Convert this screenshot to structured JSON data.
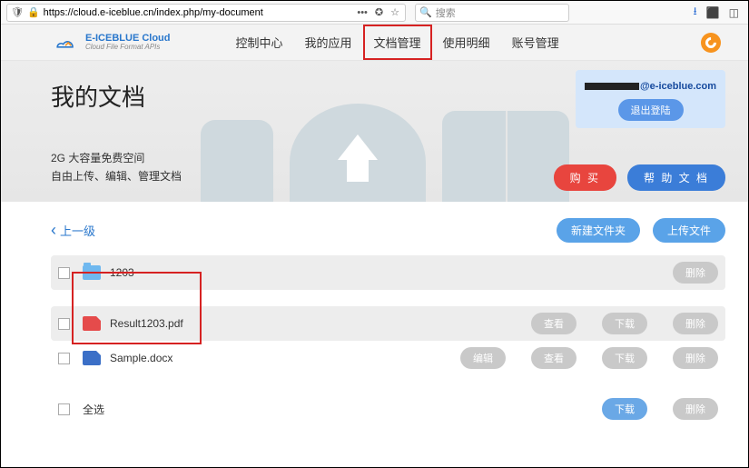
{
  "browser": {
    "url": "https://cloud.e-iceblue.cn/index.php/my-document",
    "search_placeholder": "搜索"
  },
  "brand": {
    "title": "E-ICEBLUE Cloud",
    "subtitle": "Cloud File Format APIs"
  },
  "nav": {
    "items": [
      {
        "label": "控制中心"
      },
      {
        "label": "我的应用"
      },
      {
        "label": "文档管理",
        "active": true
      },
      {
        "label": "使用明细"
      },
      {
        "label": "账号管理"
      }
    ]
  },
  "banner": {
    "title": "我的文档",
    "sub_line1": "2G 大容量免费空间",
    "sub_line2": "自由上传、编辑、管理文档",
    "email_suffix": "@e-iceblue.com",
    "logout": "退出登陆",
    "buy": "购 买",
    "help_doc": "帮 助 文 档"
  },
  "toolbar": {
    "up": "上一级",
    "new_folder": "新建文件夹",
    "upload": "上传文件"
  },
  "files": [
    {
      "name": "1203",
      "type": "folder",
      "actions": [
        "删除"
      ]
    },
    {
      "name": "Result1203.pdf",
      "type": "pdf",
      "actions": [
        "查看",
        "下载",
        "删除"
      ]
    },
    {
      "name": "Sample.docx",
      "type": "docx",
      "actions": [
        "编辑",
        "查看",
        "下载",
        "删除"
      ]
    }
  ],
  "footer": {
    "select_all": "全选",
    "download": "下载",
    "delete": "删除"
  }
}
